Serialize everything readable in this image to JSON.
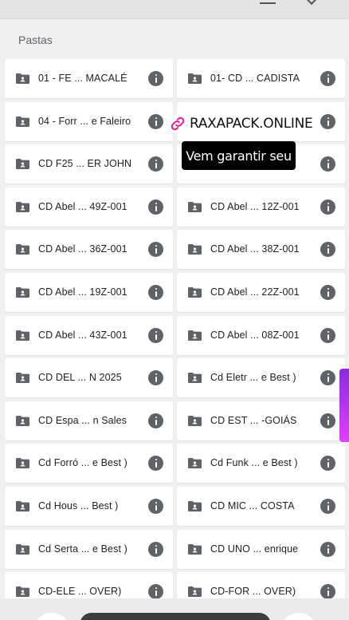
{
  "section": {
    "title": "Pastas"
  },
  "folders": [
    {
      "name": "01 - FE ... MACALÉ",
      "icon": "shared-folder-icon"
    },
    {
      "name": "01- CD ... CADISTA",
      "icon": "shared-folder-icon"
    },
    {
      "name": "04 - Forr ... e Faleiro",
      "icon": "shared-folder-icon"
    },
    {
      "name": "",
      "icon": "shared-folder-icon"
    },
    {
      "name": "CD F25 ... ER JOHN",
      "icon": "shared-folder-icon"
    },
    {
      "name": "",
      "icon": "shared-folder-icon"
    },
    {
      "name": "CD Abel ... 49Z-001",
      "icon": "shared-folder-icon"
    },
    {
      "name": "CD Abel ... 12Z-001",
      "icon": "shared-folder-icon"
    },
    {
      "name": "CD Abel ... 36Z-001",
      "icon": "shared-folder-icon"
    },
    {
      "name": "CD Abel ... 38Z-001",
      "icon": "shared-folder-icon"
    },
    {
      "name": "CD Abel ... 19Z-001",
      "icon": "shared-folder-icon"
    },
    {
      "name": "CD Abel ... 22Z-001",
      "icon": "shared-folder-icon"
    },
    {
      "name": "CD Abel ... 43Z-001",
      "icon": "shared-folder-icon"
    },
    {
      "name": "CD Abel ... 08Z-001",
      "icon": "shared-folder-icon"
    },
    {
      "name": "CD DEL ... N 2025",
      "icon": "shared-folder-icon"
    },
    {
      "name": "Cd Eletr ... e Best )",
      "icon": "shared-folder-icon"
    },
    {
      "name": "CD Espa ... n Sales",
      "icon": "shared-folder-icon"
    },
    {
      "name": "CD EST ... -GOIÁS",
      "icon": "shared-folder-icon"
    },
    {
      "name": "Cd Forró ... e Best )",
      "icon": "shared-folder-icon"
    },
    {
      "name": "Cd Funk ... e Best )",
      "icon": "shared-folder-icon"
    },
    {
      "name": "Cd Hous ... Best )",
      "icon": "shared-folder-icon"
    },
    {
      "name": "CD MIC ... COSTA",
      "icon": "shared-folder-icon"
    },
    {
      "name": "Cd Serta ... e Best )",
      "icon": "shared-folder-icon"
    },
    {
      "name": "CD UNO ... enrique",
      "icon": "shared-folder-icon"
    },
    {
      "name": "CD-ELE ... OVER)",
      "icon": "shared-folder-icon"
    },
    {
      "name": "CD-FOR ... OVER)",
      "icon": "shared-folder-icon"
    }
  ],
  "overlay": {
    "brand": "RAXAPACK.ONLINE",
    "tooltip": "Vem garantir seu",
    "brand_color": "#e91e8c"
  },
  "colors": {
    "background": "#f0f0f0",
    "card": "#ffffff",
    "icon": "#5f6368",
    "accent": "#c026d3"
  }
}
